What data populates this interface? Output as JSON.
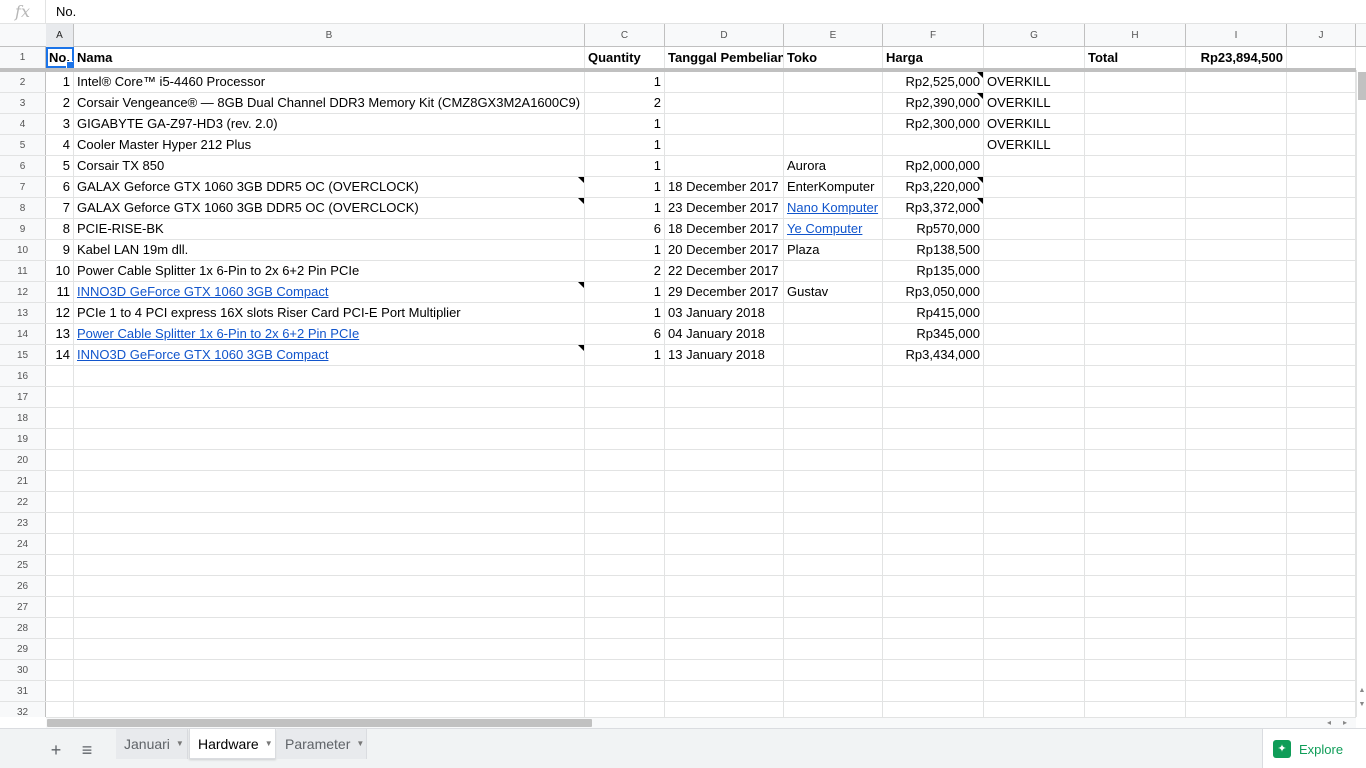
{
  "formula_bar": {
    "fx": "fx",
    "value": "No."
  },
  "columns": [
    "A",
    "B",
    "C",
    "D",
    "E",
    "F",
    "G",
    "H",
    "I",
    "J"
  ],
  "header": {
    "a": "No.",
    "b": "Nama",
    "c": "Quantity",
    "d": "Tanggal Pembelian",
    "e": "Toko",
    "f": "Harga",
    "g": "",
    "h": "Total",
    "i": "Rp23,894,500",
    "j": ""
  },
  "rows": [
    {
      "n": "2",
      "a": "1",
      "b": "Intel® Core™ i5-4460 Processor",
      "c": "1",
      "d": "",
      "e": "",
      "f": "Rp2,525,000",
      "g": "OVERKILL"
    },
    {
      "n": "3",
      "a": "2",
      "b": "Corsair Vengeance® — 8GB Dual Channel DDR3 Memory Kit (CMZ8GX3M2A1600C9)",
      "c": "2",
      "d": "",
      "e": "",
      "f": "Rp2,390,000",
      "g": "OVERKILL"
    },
    {
      "n": "4",
      "a": "3",
      "b": "GIGABYTE GA-Z97-HD3 (rev. 2.0)",
      "c": "1",
      "d": "",
      "e": "",
      "f": "Rp2,300,000",
      "g": "OVERKILL"
    },
    {
      "n": "5",
      "a": "4",
      "b": "Cooler Master Hyper 212 Plus",
      "c": "1",
      "d": "",
      "e": "",
      "f": "",
      "g": "OVERKILL"
    },
    {
      "n": "6",
      "a": "5",
      "b": "Corsair TX 850",
      "c": "1",
      "d": "",
      "e": "Aurora",
      "f": "Rp2,000,000",
      "g": ""
    },
    {
      "n": "7",
      "a": "6",
      "b": "GALAX Geforce GTX 1060 3GB DDR5 OC (OVERCLOCK)",
      "c": "1",
      "d": "18 December 2017",
      "e": "EnterKomputer",
      "f": "Rp3,220,000",
      "g": ""
    },
    {
      "n": "8",
      "a": "7",
      "b": "GALAX Geforce GTX 1060 3GB DDR5 OC (OVERCLOCK)",
      "c": "1",
      "d": "23 December 2017",
      "e": "Nano Komputer",
      "f": "Rp3,372,000",
      "g": ""
    },
    {
      "n": "9",
      "a": "8",
      "b": "PCIE-RISE-BK",
      "c": "6",
      "d": "18 December 2017",
      "e": "Ye Computer",
      "f": "Rp570,000",
      "g": ""
    },
    {
      "n": "10",
      "a": "9",
      "b": "Kabel LAN 19m dll.",
      "c": "1",
      "d": "20 December 2017",
      "e": "Plaza",
      "f": "Rp138,500",
      "g": ""
    },
    {
      "n": "11",
      "a": "10",
      "b": "Power Cable Splitter 1x 6-Pin to 2x 6+2 Pin PCIe",
      "c": "2",
      "d": "22 December 2017",
      "e": "",
      "f": "Rp135,000",
      "g": ""
    },
    {
      "n": "12",
      "a": "11",
      "b": "INNO3D GeForce GTX 1060 3GB Compact",
      "c": "1",
      "d": "29 December 2017",
      "e": "Gustav",
      "f": "Rp3,050,000",
      "g": ""
    },
    {
      "n": "13",
      "a": "12",
      "b": "PCIe 1 to 4 PCI express 16X slots Riser Card PCI-E Port Multiplier",
      "c": "1",
      "d": "03 January 2018",
      "e": "",
      "f": "Rp415,000",
      "g": ""
    },
    {
      "n": "14",
      "a": "13",
      "b": "Power Cable Splitter 1x 6-Pin to 2x 6+2 Pin PCIe",
      "c": "6",
      "d": "04 January 2018",
      "e": "",
      "f": "Rp345,000",
      "g": ""
    },
    {
      "n": "15",
      "a": "14",
      "b": "INNO3D GeForce GTX 1060 3GB Compact",
      "c": "1",
      "d": "13 January 2018",
      "e": "",
      "f": "Rp3,434,000",
      "g": ""
    }
  ],
  "empty_rows": [
    "16",
    "17",
    "18",
    "19",
    "20",
    "21",
    "22",
    "23",
    "24",
    "25",
    "26",
    "27",
    "28",
    "29",
    "30",
    "31",
    "32"
  ],
  "sheets": {
    "add_label": "+",
    "list_label": "≡",
    "tabs": [
      "Januari",
      "Hardware",
      "Parameter"
    ],
    "active": "Hardware"
  },
  "explore": {
    "label": "Explore",
    "icon": "explore-icon"
  },
  "colors": {
    "link": "#1155cc",
    "selection": "#1a73e8",
    "explore": "#0f9d58"
  }
}
